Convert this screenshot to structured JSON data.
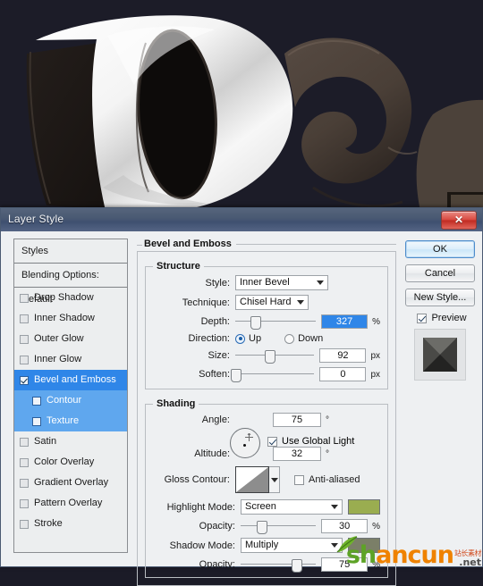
{
  "window": {
    "title": "Layer Style",
    "close_label": "✕"
  },
  "styles_panel": {
    "header": "Styles",
    "blending_options": "Blending Options: Default",
    "items": [
      {
        "label": "Drop Shadow",
        "checked": false,
        "selected": false,
        "sub": false
      },
      {
        "label": "Inner Shadow",
        "checked": false,
        "selected": false,
        "sub": false
      },
      {
        "label": "Outer Glow",
        "checked": false,
        "selected": false,
        "sub": false
      },
      {
        "label": "Inner Glow",
        "checked": false,
        "selected": false,
        "sub": false
      },
      {
        "label": "Bevel and Emboss",
        "checked": true,
        "selected": true,
        "sub": false
      },
      {
        "label": "Contour",
        "checked": false,
        "selected": false,
        "sub": true
      },
      {
        "label": "Texture",
        "checked": false,
        "selected": false,
        "sub": true
      },
      {
        "label": "Satin",
        "checked": false,
        "selected": false,
        "sub": false
      },
      {
        "label": "Color Overlay",
        "checked": false,
        "selected": false,
        "sub": false
      },
      {
        "label": "Gradient Overlay",
        "checked": false,
        "selected": false,
        "sub": false
      },
      {
        "label": "Pattern Overlay",
        "checked": false,
        "selected": false,
        "sub": false
      },
      {
        "label": "Stroke",
        "checked": false,
        "selected": false,
        "sub": false
      }
    ]
  },
  "main": {
    "section_title": "Bevel and Emboss",
    "structure": {
      "legend": "Structure",
      "style_label": "Style:",
      "style_value": "Inner Bevel",
      "technique_label": "Technique:",
      "technique_value": "Chisel Hard",
      "depth_label": "Depth:",
      "depth_value": "327",
      "depth_unit": "%",
      "depth_slider_pct": 24,
      "direction_label": "Direction:",
      "direction_up": "Up",
      "direction_down": "Down",
      "direction_selected": "Up",
      "size_label": "Size:",
      "size_value": "92",
      "size_unit": "px",
      "size_slider_pct": 43,
      "soften_label": "Soften:",
      "soften_value": "0",
      "soften_unit": "px",
      "soften_slider_pct": 0
    },
    "shading": {
      "legend": "Shading",
      "angle_label": "Angle:",
      "angle_value": "75",
      "angle_unit": "°",
      "global_light_label": "Use Global Light",
      "global_light_checked": true,
      "altitude_label": "Altitude:",
      "altitude_value": "32",
      "altitude_unit": "°",
      "gloss_contour_label": "Gloss Contour:",
      "anti_aliased_label": "Anti-aliased",
      "anti_aliased_checked": false,
      "highlight_mode_label": "Highlight Mode:",
      "highlight_mode_value": "Screen",
      "highlight_color": "#9aad50",
      "highlight_opacity_label": "Opacity:",
      "highlight_opacity_value": "30",
      "highlight_opacity_unit": "%",
      "highlight_opacity_pct": 27,
      "shadow_mode_label": "Shadow Mode:",
      "shadow_mode_value": "Multiply",
      "shadow_color": "#7b7f68",
      "shadow_opacity_label": "Opacity:",
      "shadow_opacity_value": "75",
      "shadow_opacity_unit": "%",
      "shadow_opacity_pct": 74
    }
  },
  "buttons": {
    "ok": "OK",
    "cancel": "Cancel",
    "new_style": "New Style...",
    "preview_label": "Preview",
    "preview_checked": true
  },
  "watermark": {
    "part_green": "sh",
    "part_orange": "ancun",
    "cn_text": "站长素材",
    "net_text": ".net"
  },
  "colors": {
    "title_bar": "#4a5a73",
    "dialog_bg": "#eef0f2",
    "selection_blue": "#2f86e8",
    "sub_selection_blue": "#5fa7ee",
    "close_red": "#c02a21"
  }
}
